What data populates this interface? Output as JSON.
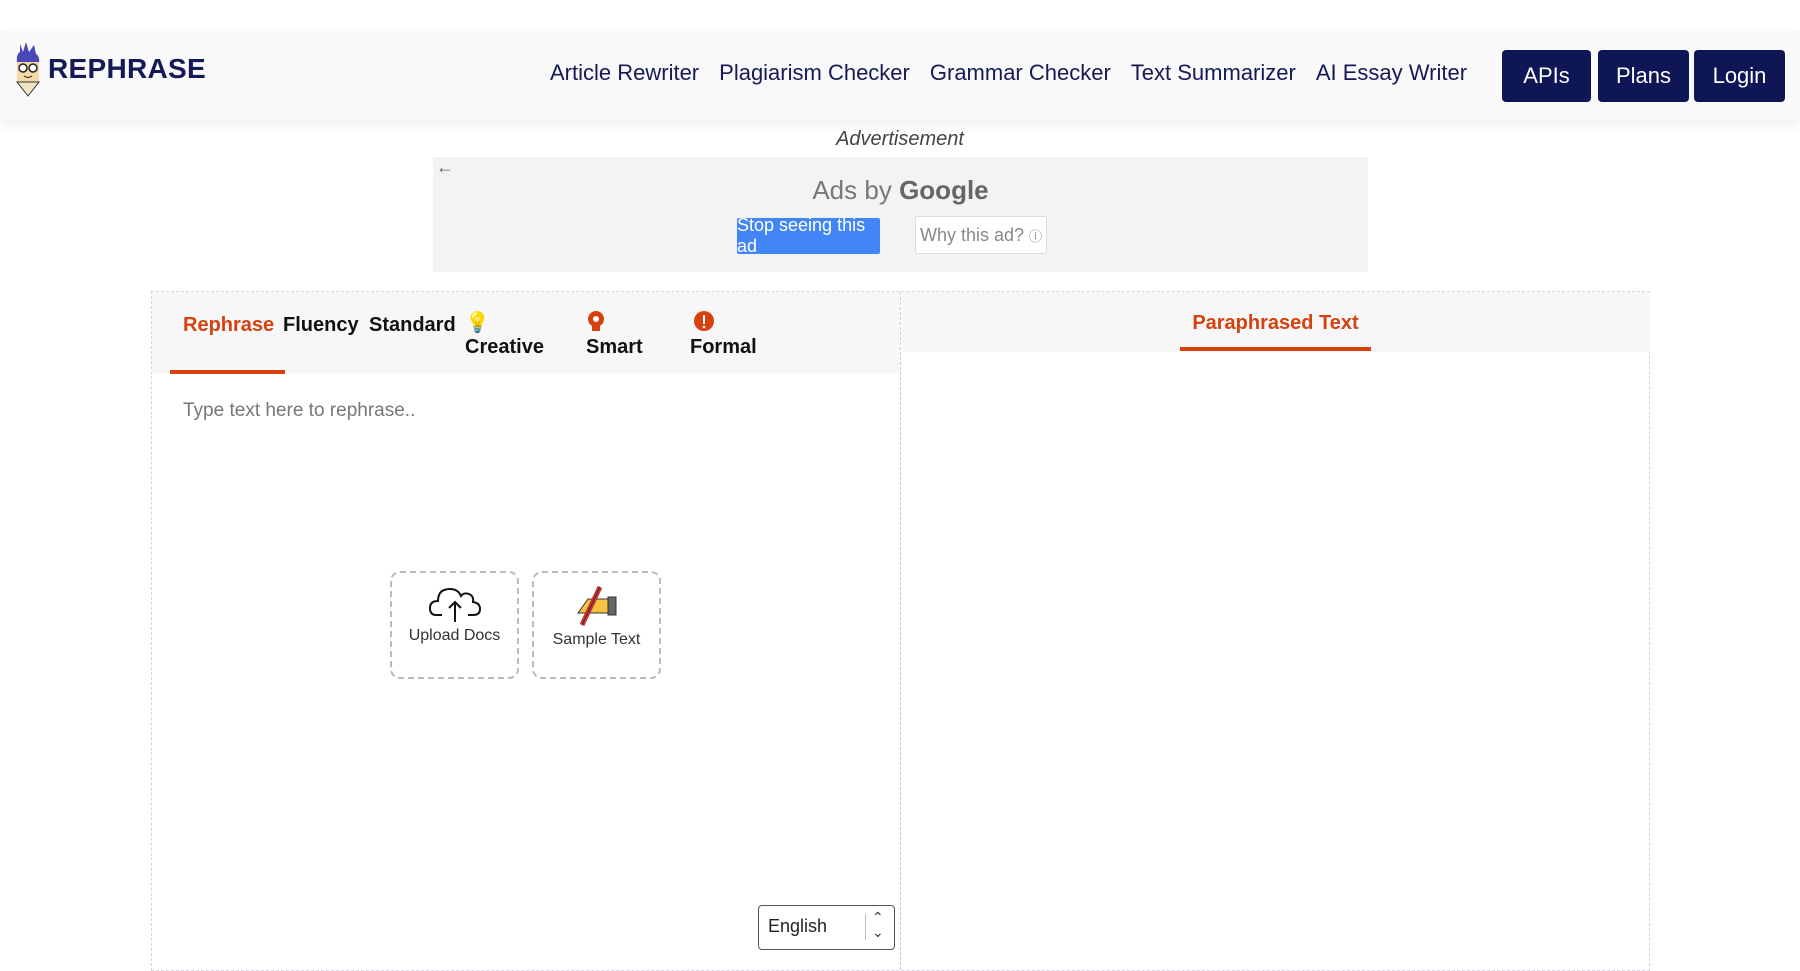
{
  "header": {
    "brand": "REPHRASE",
    "nav": [
      "Article Rewriter",
      "Plagiarism Checker",
      "Grammar Checker",
      "Text Summarizer",
      "AI Essay Writer"
    ],
    "buttons": {
      "apis": "APIs",
      "plans": "Plans",
      "login": "Login"
    }
  },
  "ad": {
    "label": "Advertisement",
    "ads_by": "Ads by",
    "google": "Google",
    "stop": "Stop seeing this ad",
    "why": "Why this ad?"
  },
  "editor": {
    "tabs": [
      "Rephrase",
      "Fluency",
      "Standard",
      "Creative",
      "Smart",
      "Formal"
    ],
    "active_tab": "Rephrase",
    "placeholder": "Type text here to rephrase..",
    "upload": "Upload Docs",
    "sample": "Sample Text",
    "language": "English"
  },
  "output": {
    "tab": "Paraphrased Text"
  },
  "colors": {
    "brand": "#0f1656",
    "accent": "#d5420f",
    "ad_button": "#4285f4"
  }
}
